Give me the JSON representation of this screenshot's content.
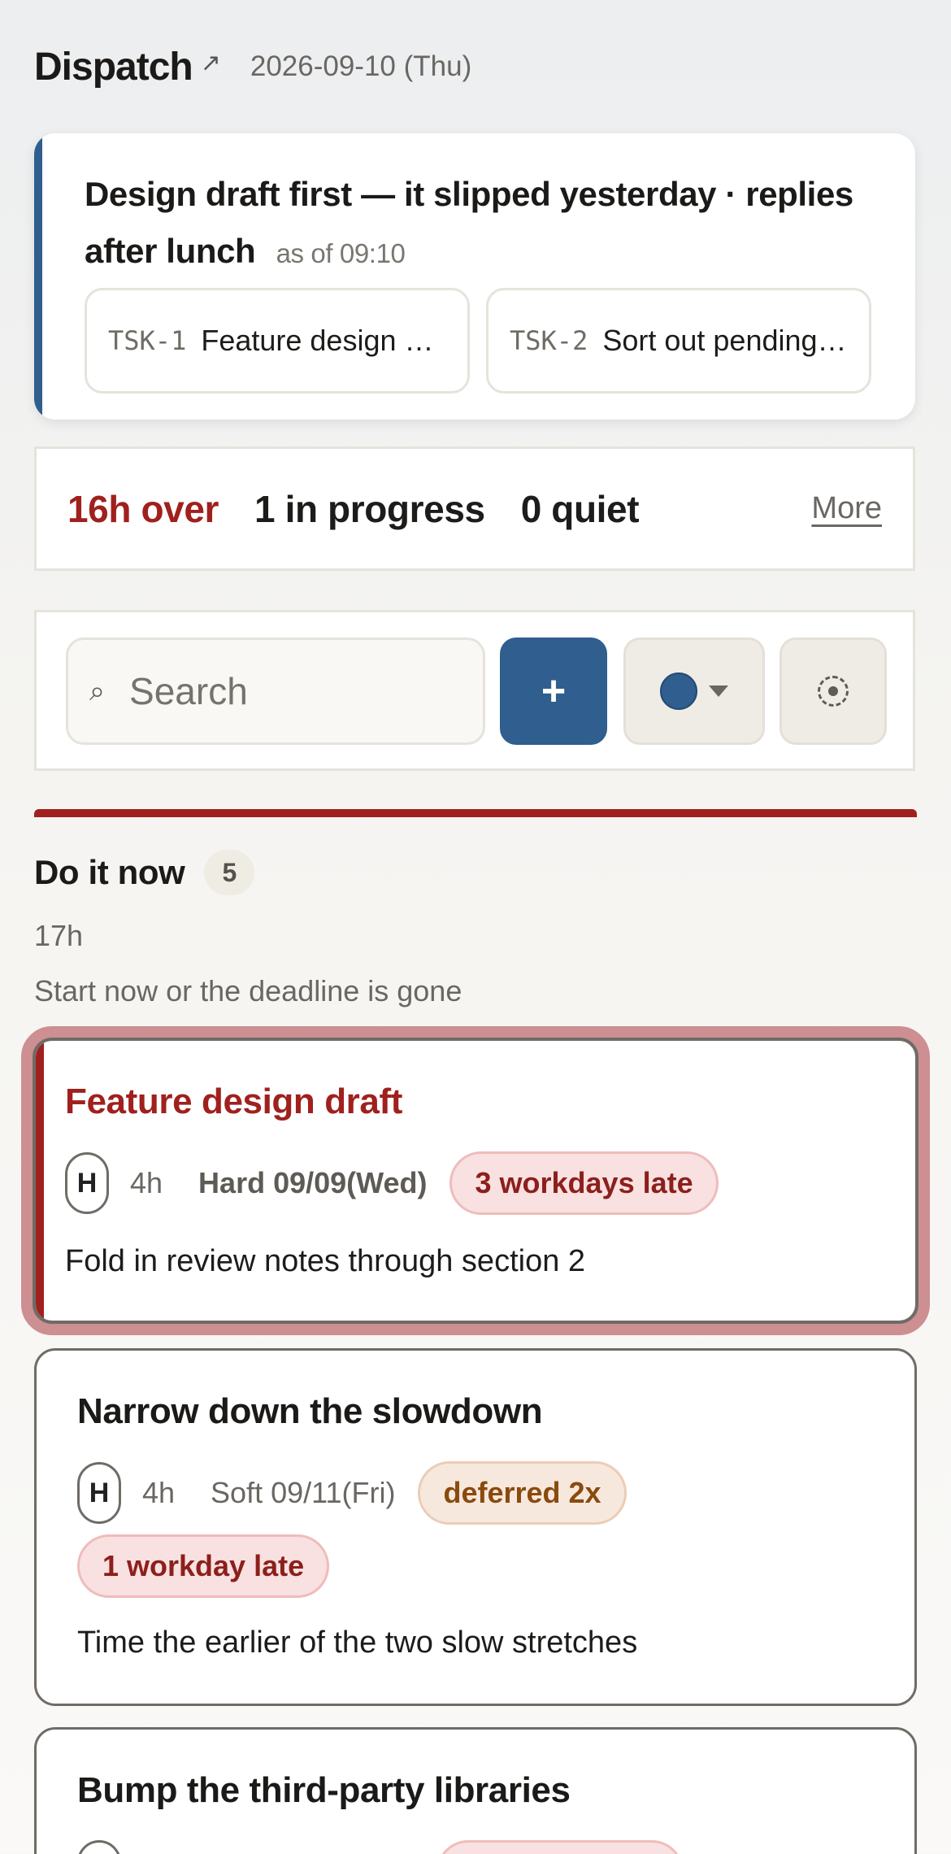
{
  "header": {
    "title": "Dispatch",
    "title_icon": "arrow-up-right-icon",
    "date": "2026-09-10 (Thu)"
  },
  "focus": {
    "message": "Design draft first — it slipped yesterday · replies after lunch",
    "as_of": "as of 09:10",
    "accent_color": "#2f5e8f",
    "tasks": [
      {
        "id": "TSK-1",
        "title": "Feature design draft"
      },
      {
        "id": "TSK-2",
        "title": "Sort out pending replies"
      }
    ]
  },
  "stats": {
    "over": "16h over",
    "in_progress": "1 in progress",
    "quiet": "0 quiet",
    "more_label": "More",
    "over_color": "#a0201e"
  },
  "toolbar": {
    "search_placeholder": "Search",
    "search_icon": "search-icon",
    "add_label": "+",
    "color_filter": "#2f5e8f",
    "focus_icon": "focus-target-icon"
  },
  "section": {
    "title": "Do it now",
    "count": "5",
    "hours": "17h",
    "subtitle": "Start now or the deadline is gone",
    "color": "#a0201e"
  },
  "tasks": [
    {
      "title": "Feature design draft",
      "priority": "H",
      "estimate": "4h",
      "deadline": "Hard 09/09(Wed)",
      "late": "3 workdays late",
      "note": "Fold in review notes through section 2"
    },
    {
      "title": "Narrow down the slowdown",
      "priority": "H",
      "estimate": "4h",
      "deadline": "Soft 09/11(Fri)",
      "deferred": "deferred 2x",
      "late": "1 workday late",
      "note": "Time the earlier of the two slow stretches"
    },
    {
      "title": "Bump the third-party libraries"
    }
  ]
}
